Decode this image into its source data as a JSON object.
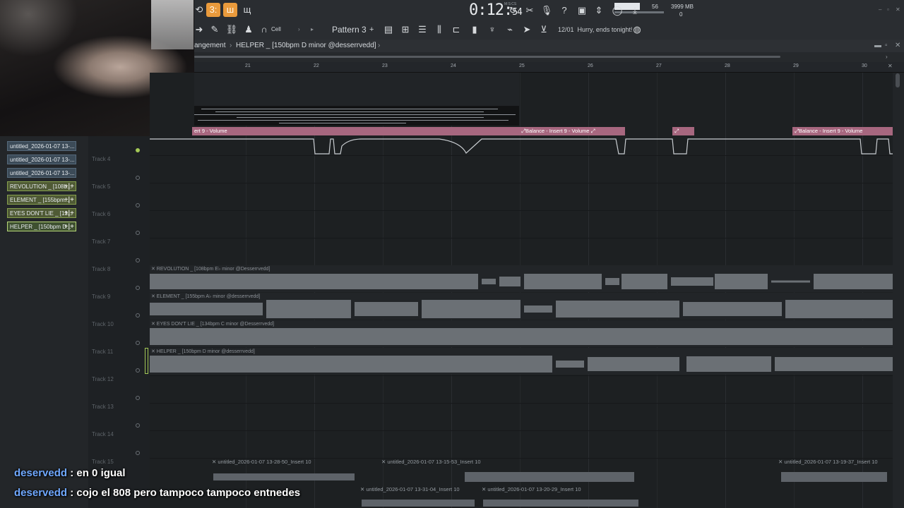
{
  "toolbar": {
    "time": "0:12",
    "time_small": "54",
    "time_unit": "M:S:CS",
    "cpu_value": "56",
    "memory": "3999 MB",
    "poly": "0",
    "snap_mode": "Cell",
    "pattern": "Pattern 3",
    "news_date": "12/01",
    "news_text": "Hurry, ends tonight!"
  },
  "window": {
    "breadcrumb_prefix": "angement",
    "breadcrumb_sep": "›",
    "project_title": "HELPER _ [150bpm D minor @desserrvedd]"
  },
  "ruler": {
    "bars": [
      "21",
      "22",
      "23",
      "24",
      "25",
      "26",
      "27",
      "28",
      "29",
      "30"
    ]
  },
  "automation": {
    "clips": [
      {
        "label": "ert 9 - Volume"
      },
      {
        "label": "⤢Balance - Insert 9 - Volume ⤢"
      },
      {
        "label": "⤢"
      },
      {
        "label": "⤢Balance - Insert 9 - Volume"
      }
    ]
  },
  "picker": {
    "items": [
      {
        "label": "untitled_2026-01-07 13-...",
        "type": "automation"
      },
      {
        "label": "untitled_2026-01-07 13-...",
        "type": "automation"
      },
      {
        "label": "untitled_2026-01-07 13-...",
        "type": "automation"
      },
      {
        "label": "REVOLUTION _ [108b...",
        "type": "audio"
      },
      {
        "label": "ELEMENT _ [155bpm...",
        "type": "audio"
      },
      {
        "label": "EYES DON'T LIE _ [13...",
        "type": "audio"
      },
      {
        "label": "HELPER _ [150bpm D...",
        "type": "audio"
      }
    ]
  },
  "tracks": [
    "Track 4",
    "Track 5",
    "Track 6",
    "Track 7",
    "Track 8",
    "Track 9",
    "Track 10",
    "Track 11",
    "Track 12",
    "Track 13",
    "Track 14",
    "Track 15"
  ],
  "audio_clips": [
    {
      "label": "✕ REVOLUTION _ [108bpm E♭ minor @Desserrvedd]"
    },
    {
      "label": "✕ ELEMENT _ [155bpm A♭ minor @desserrvedd]"
    },
    {
      "label": "✕ EYES DON'T LIE _ [134bpm C minor @Desserrvedd]"
    },
    {
      "label": "✕ HELPER _ [150bpm D minor @desserrvedd]"
    }
  ],
  "bottom_clips": [
    {
      "label": "✕ untitled_2026-01-07 13-28-50_Insert 10"
    },
    {
      "label": "✕ untitled_2026-01-07 13-15-53_Insert 10"
    },
    {
      "label": "✕ untitled_2026-01-07 13-19-37_Insert 10"
    },
    {
      "label": "✕ untitled_2026-01-07 13-31-04_Insert 10"
    },
    {
      "label": "✕ untitled_2026-01-07 13-20-29_Insert 10"
    }
  ],
  "chat": [
    {
      "user": "deservedd",
      "message": ": en 0 igual"
    },
    {
      "user": "deservedd",
      "message": ": cojo el 808 pero tampoco tampoco entnedes"
    }
  ]
}
